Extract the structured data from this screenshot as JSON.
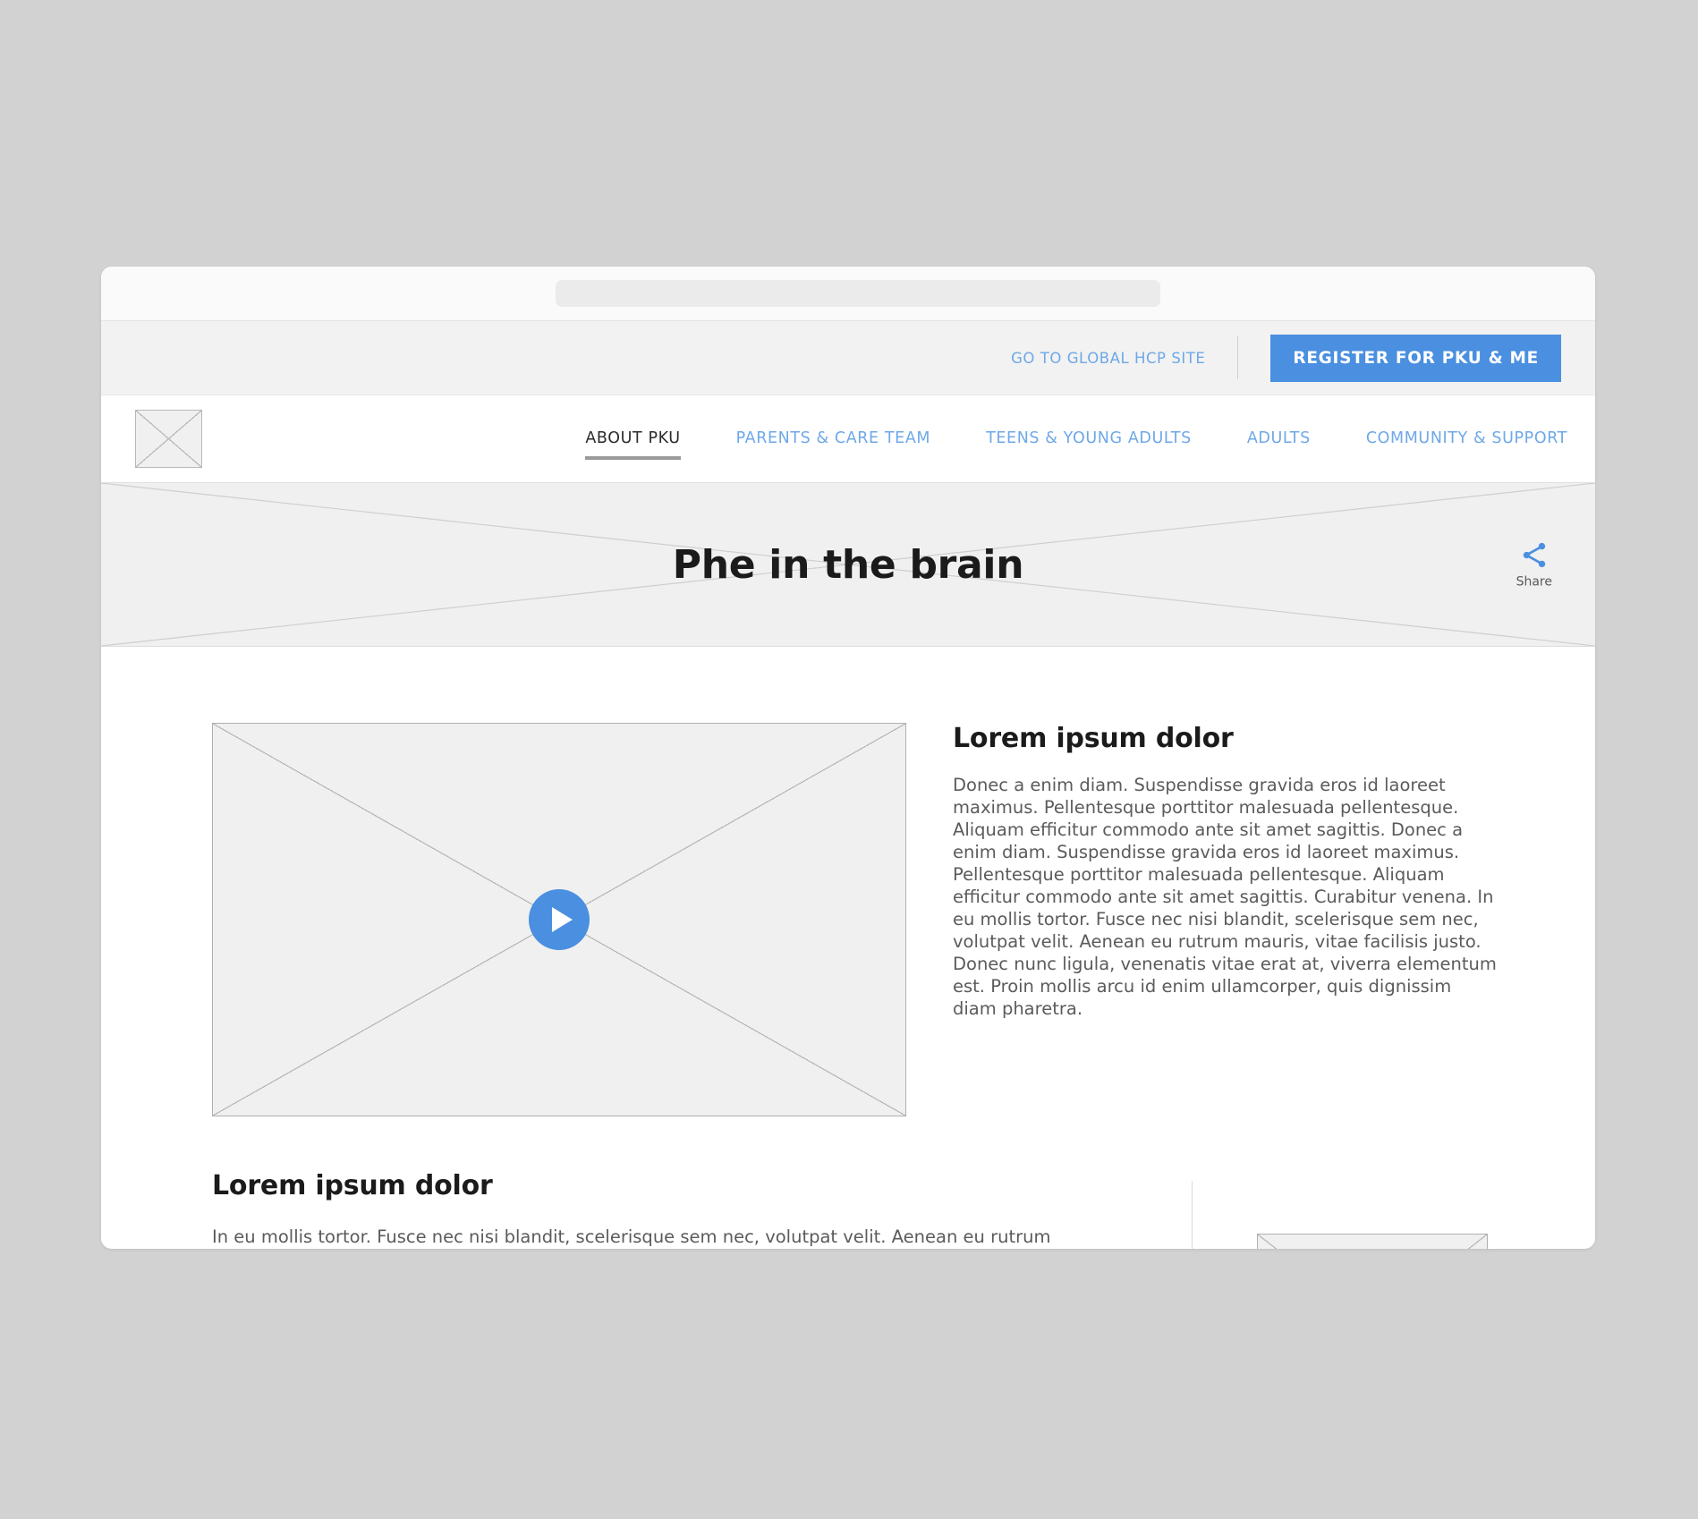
{
  "browser": {
    "address_bar_value": "",
    "address_bar_placeholder": ""
  },
  "utility_bar": {
    "hcp_link_label": "GO TO GLOBAL HCP SITE",
    "register_button_label": "REGISTER FOR PKU & ME"
  },
  "nav": {
    "logo_alt": "site-logo-placeholder",
    "items": [
      {
        "label": "ABOUT PKU",
        "active": true
      },
      {
        "label": "PARENTS & CARE TEAM",
        "active": false
      },
      {
        "label": "TEENS & YOUNG ADULTS",
        "active": false
      },
      {
        "label": "ADULTS",
        "active": false
      },
      {
        "label": "COMMUNITY & SUPPORT",
        "active": false
      }
    ]
  },
  "hero": {
    "title": "Phe in the brain",
    "share_label": "Share"
  },
  "main": {
    "video": {
      "play_label": "Play"
    },
    "section_one": {
      "heading": "Lorem ipsum dolor",
      "body": "Donec a enim diam. Suspendisse gravida eros id laoreet maximus. Pellentesque porttitor malesuada pellentesque. Aliquam efficitur commodo ante sit amet sagittis. Donec a enim diam. Suspendisse gravida eros id laoreet maximus. Pellentesque porttitor malesuada pellentesque. Aliquam efficitur commodo ante sit amet sagittis. Curabitur venena. In eu mollis tortor. Fusce nec nisi blandit, scelerisque sem nec, volutpat velit. Aenean eu rutrum mauris, vitae facilisis justo. Donec nunc ligula, venenatis vitae erat at, viverra elementum est. Proin mollis arcu id enim ullamcorper, quis dignissim diam pharetra."
    },
    "section_two": {
      "heading": "Lorem ipsum dolor",
      "body": "In eu mollis tortor. Fusce nec nisi blandit, scelerisque sem nec, volutpat velit. Aenean eu rutrum"
    }
  },
  "colors": {
    "accent_blue": "#4a8fe0",
    "link_blue": "#6ea8e8",
    "page_background": "#d2d2d2",
    "hero_background": "#f0f0f0",
    "utility_bar_background": "#f2f2f2"
  }
}
